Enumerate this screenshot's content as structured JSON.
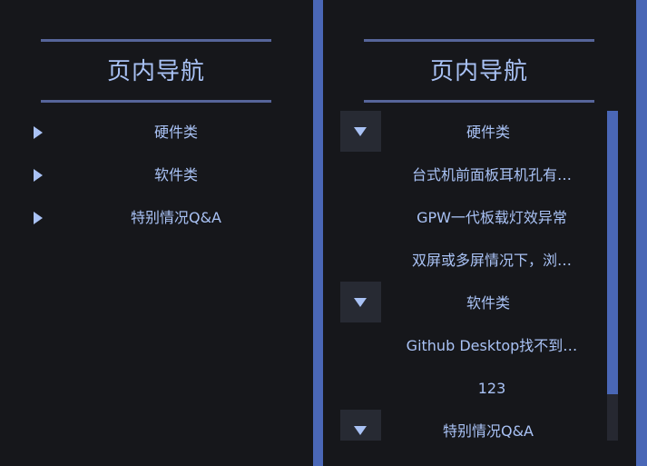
{
  "left_panel": {
    "title": "页内导航",
    "items": [
      {
        "label": "硬件类"
      },
      {
        "label": "软件类"
      },
      {
        "label": "特别情况Q&A"
      }
    ]
  },
  "right_panel": {
    "title": "页内导航",
    "groups": [
      {
        "label": "硬件类",
        "children": [
          {
            "label": "台式机前面板耳机孔有…"
          },
          {
            "label": "GPW一代板载灯效异常"
          },
          {
            "label": "双屏或多屏情况下，浏…"
          }
        ]
      },
      {
        "label": "软件类",
        "children": [
          {
            "label": "Github Desktop找不到…"
          },
          {
            "label": "123"
          }
        ]
      },
      {
        "label": "特别情况Q&A",
        "children": []
      }
    ],
    "scroll_fraction_visible": 0.86
  },
  "colors": {
    "background": "#16171b",
    "accent": "#4a67b6",
    "text": "#a9c2f5",
    "rule": "#56659a",
    "toggle_open_bg": "#272a33"
  }
}
